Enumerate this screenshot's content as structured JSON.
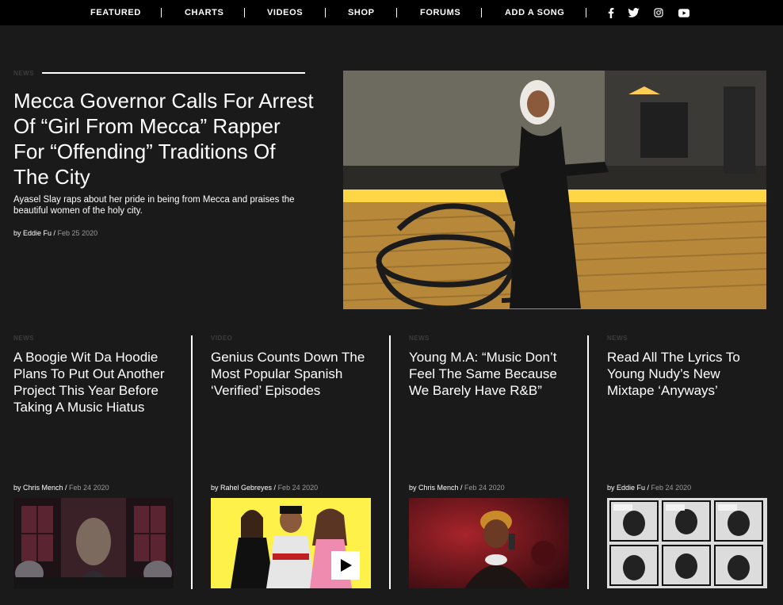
{
  "nav": {
    "items": [
      "FEATURED",
      "CHARTS",
      "VIDEOS",
      "SHOP",
      "FORUMS",
      "ADD A SONG"
    ],
    "social": [
      "facebook-icon",
      "twitter-icon",
      "instagram-icon",
      "youtube-icon"
    ]
  },
  "hero": {
    "label": "NEWS",
    "title": "Mecca Governor Calls For Arrest Of “Girl From Mecca” Rapper For “Offending” Traditions Of The City",
    "description": "Ayasel Slay raps about her pride in being from Mecca and praises the beautiful women of the holy city.",
    "author": "by Eddie Fu /",
    "date": "Feb 25 2020"
  },
  "cards": [
    {
      "label": "NEWS",
      "title": "A Boogie Wit Da Hoodie Plans To Put Out Another Project This Year Before Taking A Music Hiatus",
      "author": "by Chris Mench /",
      "date": "Feb 24 2020"
    },
    {
      "label": "VIDEO",
      "title": "Genius Counts Down The Most Popular Spanish ‘Verified’ Episodes",
      "author": "by Rahel Gebreyes /",
      "date": "Feb 24 2020"
    },
    {
      "label": "NEWS",
      "title": "Young M.A: “Music Don’t Feel The Same Because We Barely Have R&B”",
      "author": "by Chris Mench /",
      "date": "Feb 24 2020"
    },
    {
      "label": "NEWS",
      "title": "Read All The Lyrics To Young Nudy’s New Mixtape ‘Anyways’",
      "author": "by Eddie Fu /",
      "date": "Feb 24 2020"
    }
  ],
  "colors": {
    "page_bg": "#1a1a1a",
    "nav_bg": "#000000",
    "label": "#3c3c3c",
    "date": "#9a9a9a",
    "yellow_thumb": "#fef24a"
  }
}
